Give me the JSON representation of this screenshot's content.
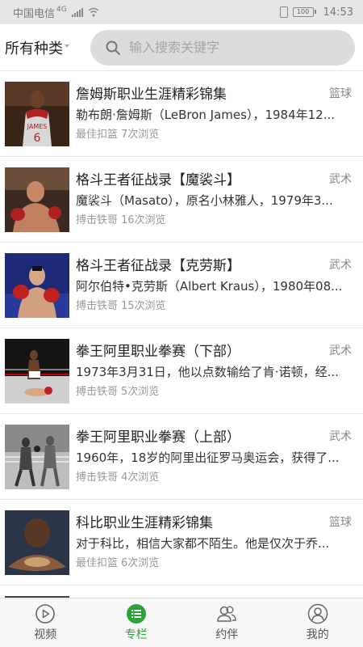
{
  "status": {
    "carrier": "中国电信",
    "network": "4G",
    "battery": "100",
    "time": "14:53"
  },
  "header": {
    "category_label": "所有种类",
    "search_placeholder": "输入搜索关键字"
  },
  "items": [
    {
      "title": "詹姆斯职业生涯精彩锦集",
      "tag": "篮球",
      "desc": "勒布朗·詹姆斯（LeBron James），1984年12...",
      "author": "最佳扣篮",
      "views": "7次浏览"
    },
    {
      "title": "格斗王者征战录【魔裟斗】",
      "tag": "武术",
      "desc": "魔裟斗（Masato），原名小林雅人，1979年3...",
      "author": "搏击铁哥",
      "views": "16次浏览"
    },
    {
      "title": "格斗王者征战录【克劳斯】",
      "tag": "武术",
      "desc": "阿尔伯特•克劳斯（Albert Kraus），1980年08...",
      "author": "搏击铁哥",
      "views": "15次浏览"
    },
    {
      "title": "拳王阿里职业拳赛（下部）",
      "tag": "武术",
      "desc": "1973年3月31日，他以点数输给了肯·诺顿，经...",
      "author": "搏击铁哥",
      "views": "5次浏览"
    },
    {
      "title": "拳王阿里职业拳赛（上部）",
      "tag": "武术",
      "desc": "1960年，18岁的阿里出征罗马奥运会，获得了...",
      "author": "搏击铁哥",
      "views": "4次浏览"
    },
    {
      "title": "科比职业生涯精彩锦集",
      "tag": "篮球",
      "desc": "对于科比，相信大家都不陌生。他是仅次于乔...",
      "author": "最佳扣篮",
      "views": "6次浏览"
    }
  ],
  "tabs": [
    {
      "label": "视频",
      "icon": "play-circle-icon",
      "active": false
    },
    {
      "label": "专栏",
      "icon": "list-icon",
      "active": true
    },
    {
      "label": "约伴",
      "icon": "people-icon",
      "active": false
    },
    {
      "label": "我的",
      "icon": "person-icon",
      "active": false
    }
  ],
  "colors": {
    "accent": "#2ca33a",
    "search_bg": "#dcdcdc"
  }
}
